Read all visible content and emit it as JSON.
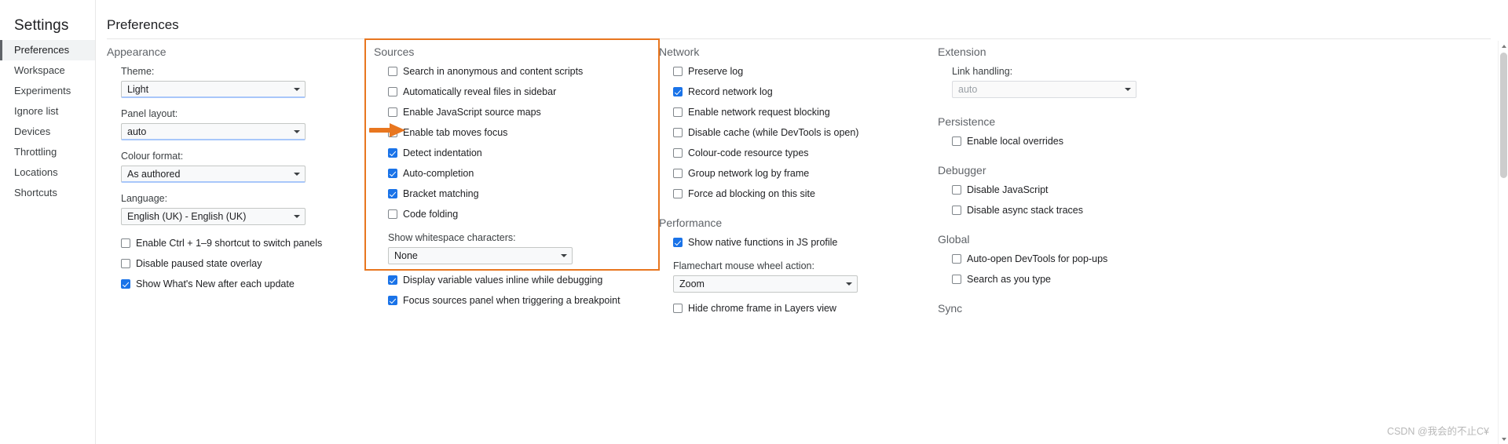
{
  "window": {
    "close_label": "✕"
  },
  "sidebar": {
    "title": "Settings",
    "items": [
      {
        "label": "Preferences",
        "selected": true
      },
      {
        "label": "Workspace",
        "selected": false
      },
      {
        "label": "Experiments",
        "selected": false
      },
      {
        "label": "Ignore list",
        "selected": false
      },
      {
        "label": "Devices",
        "selected": false
      },
      {
        "label": "Throttling",
        "selected": false
      },
      {
        "label": "Locations",
        "selected": false
      },
      {
        "label": "Shortcuts",
        "selected": false
      }
    ]
  },
  "page": {
    "title": "Preferences"
  },
  "columns": {
    "col1": {
      "heading": "Appearance",
      "theme_label": "Theme:",
      "theme_value": "Light",
      "panel_layout_label": "Panel layout:",
      "panel_layout_value": "auto",
      "colour_format_label": "Colour format:",
      "colour_format_value": "As authored",
      "language_label": "Language:",
      "language_value": "English (UK) - English (UK)",
      "checks": [
        {
          "label": "Enable Ctrl + 1–9 shortcut to switch panels",
          "checked": false
        },
        {
          "label": "Disable paused state overlay",
          "checked": false
        },
        {
          "label": "Show What's New after each update",
          "checked": true
        }
      ]
    },
    "col2": {
      "heading": "Sources",
      "checks": [
        {
          "label": "Search in anonymous and content scripts",
          "checked": false
        },
        {
          "label": "Automatically reveal files in sidebar",
          "checked": false
        },
        {
          "label": "Enable JavaScript source maps",
          "checked": false
        },
        {
          "label": "Enable tab moves focus",
          "checked": false
        },
        {
          "label": "Detect indentation",
          "checked": true
        },
        {
          "label": "Auto-completion",
          "checked": true
        },
        {
          "label": "Bracket matching",
          "checked": true
        },
        {
          "label": "Code folding",
          "checked": false
        }
      ],
      "whitespace_label": "Show whitespace characters:",
      "whitespace_value": "None",
      "checks_after": [
        {
          "label": "Display variable values inline while debugging",
          "checked": true
        },
        {
          "label": "Focus sources panel when triggering a breakpoint",
          "checked": true
        }
      ]
    },
    "col3": {
      "heading": "Network",
      "checks": [
        {
          "label": "Preserve log",
          "checked": false
        },
        {
          "label": "Record network log",
          "checked": true
        },
        {
          "label": "Enable network request blocking",
          "checked": false
        },
        {
          "label": "Disable cache (while DevTools is open)",
          "checked": false
        },
        {
          "label": "Colour-code resource types",
          "checked": false
        },
        {
          "label": "Group network log by frame",
          "checked": false
        },
        {
          "label": "Force ad blocking on this site",
          "checked": false
        }
      ],
      "perf_heading": "Performance",
      "perf_checks": [
        {
          "label": "Show native functions in JS profile",
          "checked": true
        }
      ],
      "flamechart_label": "Flamechart mouse wheel action:",
      "flamechart_value": "Zoom",
      "perf_checks_after": [
        {
          "label": "Hide chrome frame in Layers view",
          "checked": false
        }
      ]
    },
    "col4": {
      "extension_heading": "Extension",
      "link_handling_label": "Link handling:",
      "link_handling_value": "auto",
      "persistence_heading": "Persistence",
      "persistence_checks": [
        {
          "label": "Enable local overrides",
          "checked": false
        }
      ],
      "debugger_heading": "Debugger",
      "debugger_checks": [
        {
          "label": "Disable JavaScript",
          "checked": false
        },
        {
          "label": "Disable async stack traces",
          "checked": false
        }
      ],
      "global_heading": "Global",
      "global_checks": [
        {
          "label": "Auto-open DevTools for pop-ups",
          "checked": false
        },
        {
          "label": "Search as you type",
          "checked": false
        }
      ],
      "sync_heading": "Sync"
    }
  },
  "annotations": {
    "highlight_color": "#e8761f",
    "arrow_color": "#e8761f"
  },
  "watermark": {
    "text": "CSDN @我会的不止C¥"
  }
}
